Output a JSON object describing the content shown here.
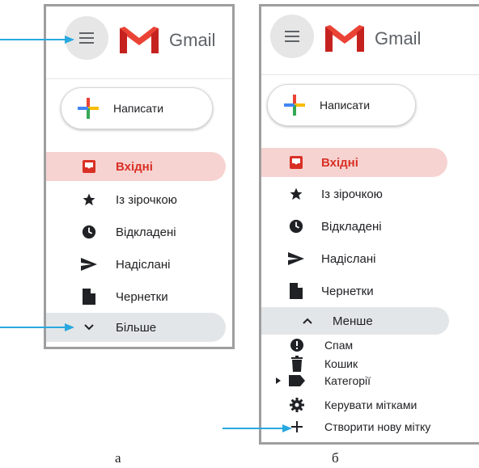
{
  "colors": {
    "accent_red": "#d93025",
    "arrow_blue": "#29a8e0",
    "active_bg": "#f6d3d1",
    "hover_bg": "#e3e6e8"
  },
  "panel_a": {
    "brand": "Gmail",
    "compose_label": "Написати",
    "nav": [
      {
        "label": "Вхідні",
        "icon": "inbox-icon",
        "active": true
      },
      {
        "label": "Із зірочкою",
        "icon": "star-icon"
      },
      {
        "label": "Відкладені",
        "icon": "clock-icon"
      },
      {
        "label": "Надіслані",
        "icon": "send-icon"
      },
      {
        "label": "Чернетки",
        "icon": "draft-icon"
      },
      {
        "label": "Більше",
        "icon": "chevron-down-icon"
      }
    ],
    "caption": "а"
  },
  "panel_b": {
    "brand": "Gmail",
    "compose_label": "Написати",
    "nav": [
      {
        "label": "Вхідні",
        "icon": "inbox-icon",
        "active": true
      },
      {
        "label": "Із зірочкою",
        "icon": "star-icon"
      },
      {
        "label": "Відкладені",
        "icon": "clock-icon"
      },
      {
        "label": "Надіслані",
        "icon": "send-icon"
      },
      {
        "label": "Чернетки",
        "icon": "draft-icon"
      },
      {
        "label": "Менше",
        "icon": "chevron-up-icon"
      }
    ],
    "extra": [
      {
        "label": "Спам",
        "icon": "spam-icon"
      },
      {
        "label": "Кошик",
        "icon": "trash-icon"
      },
      {
        "label": "Категорії",
        "icon": "label-icon"
      },
      {
        "label": "Керувати мітками",
        "icon": "settings-icon"
      },
      {
        "label": "Створити нову мітку",
        "icon": "plus-icon"
      }
    ],
    "caption": "б"
  }
}
